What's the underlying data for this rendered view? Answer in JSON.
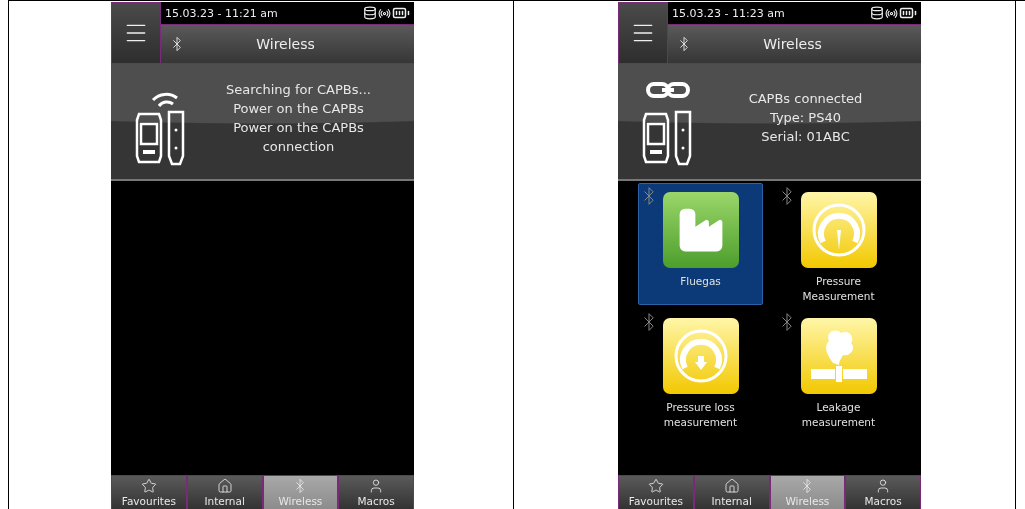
{
  "screens": [
    {
      "datetime": "15.03.23 - 11:21 am",
      "title": "Wireless",
      "info": {
        "kind": "searching",
        "lines": [
          "Searching for CAPBs...",
          "Power on the CAPBs",
          "Power on the CAPBs",
          "connection"
        ]
      },
      "nav": [
        {
          "kind": "star",
          "label": "Favourites",
          "selected": false
        },
        {
          "kind": "home",
          "label": "Internal",
          "selected": false
        },
        {
          "kind": "bluetooth",
          "label": "Wireless",
          "selected": true
        },
        {
          "kind": "user",
          "label": "Macros",
          "selected": false
        }
      ]
    },
    {
      "datetime": "15.03.23 - 11:23 am",
      "title": "Wireless",
      "info": {
        "kind": "connected",
        "lines": [
          "CAPBs connected",
          "Type: PS40",
          "Serial: 01ABC"
        ]
      },
      "tiles": [
        {
          "kind": "factory",
          "label": "Fluegas",
          "selected": true
        },
        {
          "kind": "gauge",
          "label": "Pressure Measurement",
          "selected": false
        },
        {
          "kind": "gauge-down",
          "label": "Pressure loss measurement",
          "selected": false
        },
        {
          "kind": "leak",
          "label": "Leakage measurement",
          "selected": false
        }
      ],
      "nav": [
        {
          "kind": "star",
          "label": "Favourites",
          "selected": false
        },
        {
          "kind": "home",
          "label": "Internal",
          "selected": false
        },
        {
          "kind": "bluetooth",
          "label": "Wireless",
          "selected": true
        },
        {
          "kind": "user",
          "label": "Macros",
          "selected": false
        }
      ]
    }
  ]
}
